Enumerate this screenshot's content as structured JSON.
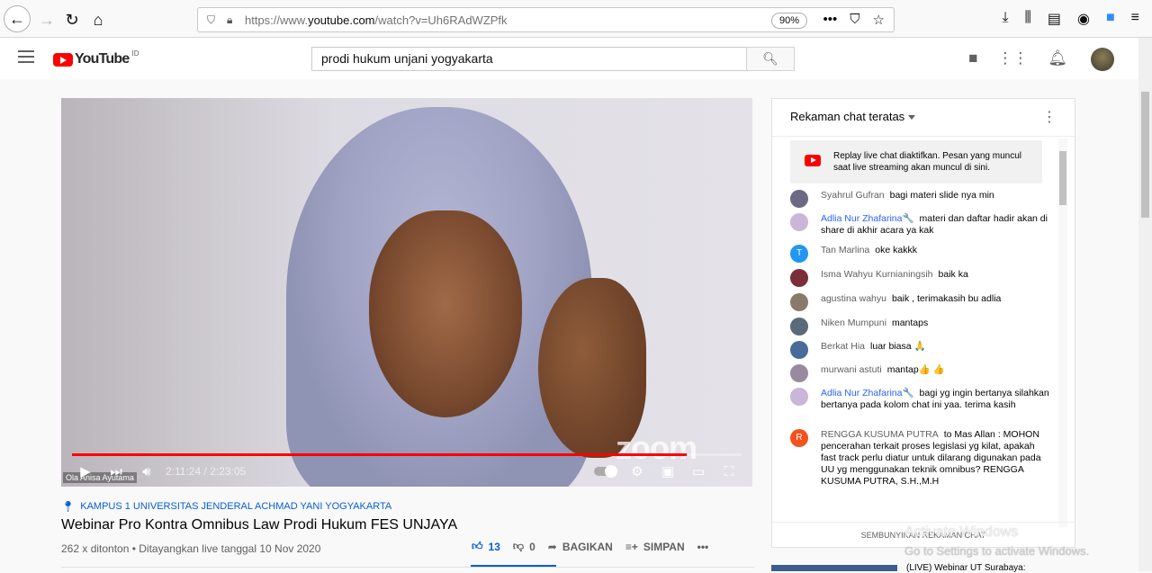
{
  "browser": {
    "url_prefix": "https://www.",
    "url_domain": "youtube.com",
    "url_path": "/watch?v=Uh6RAdWZPfk",
    "zoom": "90%"
  },
  "header": {
    "logo_text": "YouTube",
    "logo_country": "ID",
    "search_value": "prodi hukum unjani yogyakarta"
  },
  "player": {
    "participant_name": "Ola Anisa Ayutama",
    "watermark": "zoom",
    "time_display": "2:11:24 / 2:23:05",
    "progress_fraction": 0.918
  },
  "video": {
    "location": "KAMPUS 1 UNIVERSITAS JENDERAL ACHMAD YANI YOGYAKARTA",
    "title": "Webinar Pro Kontra Omnibus Law Prodi Hukum FES UNJAYA",
    "stats": "262 x ditonton • Ditayangkan live tanggal 10 Nov 2020",
    "likes": "13",
    "dislikes": "0",
    "share_label": "BAGIKAN",
    "save_label": "SIMPAN"
  },
  "chat": {
    "header_label": "Rekaman chat teratas",
    "banner_text": "Replay live chat diaktifkan. Pesan yang muncul saat live streaming akan muncul di sini.",
    "footer_label": "SEMBUNYIKAN REKAMAN CHAT",
    "messages": [
      {
        "author": "Syahrul Gufran",
        "text": "bagi materi slide nya min"
      },
      {
        "author": "Adlia Nur Zhafarina🔧",
        "text": "materi dan daftar hadir akan di share di akhir acara ya kak"
      },
      {
        "author": "Tan Marlina",
        "text": "oke kakkk"
      },
      {
        "author": "Isma Wahyu Kurnianingsih",
        "text": "baik ka"
      },
      {
        "author": "agustina wahyu",
        "text": "baik , terimakasih bu adlia"
      },
      {
        "author": "Niken Mumpuni",
        "text": "mantaps"
      },
      {
        "author": "Berkat Hia",
        "text": "luar biasa 🙏"
      },
      {
        "author": "murwani astuti",
        "text": "mantap👍 👍"
      },
      {
        "author": "Adlia Nur Zhafarina🔧",
        "text": "bagi yg ingin bertanya silahkan bertanya pada kolom chat ini yaa. terima kasih"
      },
      {
        "author": "RENGGA KUSUMA PUTRA",
        "text": "to Mas Allan : MOHON pencerahan terkait proses legislasi yg kilat, apakah fast track perlu diatur untuk dilarang digunakan pada UU yg menggunakan teknik omnibus? RENGGA KUSUMA PUTRA, S.H.,M.H"
      }
    ]
  },
  "overlay": {
    "activate_title": "Activate Windows",
    "activate_sub": "Go to Settings to activate Windows."
  },
  "next_video": {
    "title": "(LIVE) Webinar UT Surabaya:"
  }
}
